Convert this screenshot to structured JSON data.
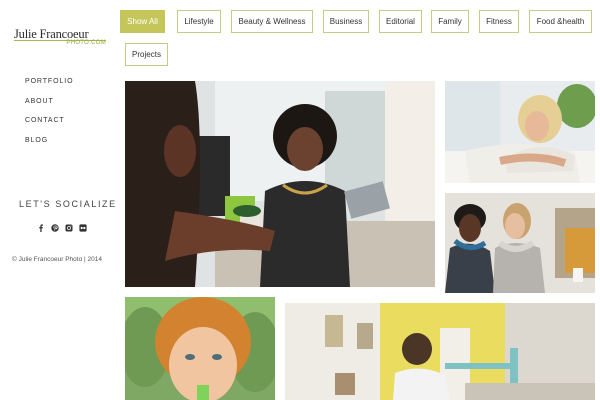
{
  "logo": {
    "name": "Julie Francoeur",
    "sub": "PHOTO.COM"
  },
  "nav": [
    {
      "label": "PORTFOLIO"
    },
    {
      "label": "ABOUT"
    },
    {
      "label": "CONTACT"
    },
    {
      "label": "BLOG"
    }
  ],
  "social": {
    "title": "LET'S SOCIALIZE",
    "icons": [
      "facebook-icon",
      "pinterest-icon",
      "instagram-icon",
      "flickr-icon"
    ]
  },
  "copyright": "© Julie Francoeur Photo | 2014",
  "filters": [
    {
      "label": "Show All",
      "active": true
    },
    {
      "label": "Lifestyle"
    },
    {
      "label": "Beauty & Wellness"
    },
    {
      "label": "Business"
    },
    {
      "label": "Editorial"
    },
    {
      "label": "Family"
    },
    {
      "label": "Fitness"
    },
    {
      "label": "Food &health"
    },
    {
      "label": "Projects"
    }
  ],
  "colors": {
    "accent": "#c5c65a",
    "border": "#c4cc85"
  }
}
